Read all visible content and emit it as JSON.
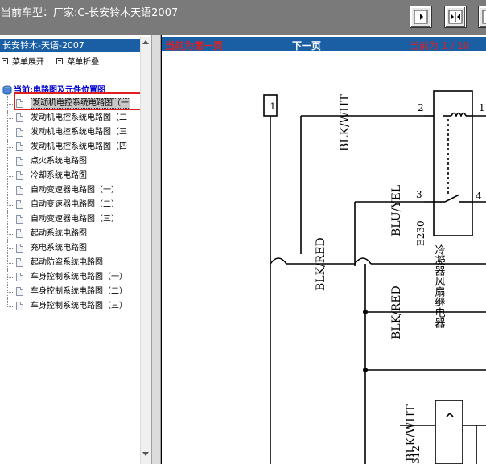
{
  "header": {
    "title": "当前车型：厂家:C-长安铃木天语2007",
    "buttons": [
      {
        "name": "single-page-button",
        "icon": "single-page-icon"
      },
      {
        "name": "double-page-button",
        "icon": "double-page-icon"
      },
      {
        "name": "fit-width-button",
        "icon": "fit-width-icon"
      }
    ]
  },
  "sidebar": {
    "title": "长安铃木-天语-2007",
    "expand_label": "菜单展开",
    "collapse_label": "菜单折叠",
    "root_label": "当前:电路图及元件位置图",
    "items": [
      "发动机电控系统电路图（一",
      "发动机电控系统电路图（二",
      "发动机电控系统电路图（三",
      "发动机电控系统电路图（四",
      "点火系统电路图",
      "冷却系统电路图",
      "自动变速器电路图（一）",
      "自动变速器电路图（二）",
      "自动变速器电路图（三）",
      "起动系统电路图",
      "充电系统电路图",
      "起动防盗系统电路图",
      "车身控制系统电路图（一）",
      "车身控制系统电路图（二）",
      "车身控制系统电路图（三）"
    ],
    "selected_index": 0
  },
  "viewer": {
    "first_page_label": "当前为第一页",
    "next_page_label": "下一页",
    "page_indicator": "当前为 1 / 10",
    "colors": {
      "nav_bg": "#1a5fa3",
      "first_page": "#e02020",
      "next_page": "#ffffff",
      "indicator": "#e02020"
    },
    "schematic": {
      "connector_label": "1",
      "wire_labels": [
        "BLK/WHT",
        "BLU/YEL",
        "BLK/RED",
        "BLK/RED",
        "BLK/WHT"
      ],
      "pin_labels": [
        "2",
        "1",
        "3",
        "4"
      ],
      "component_code": "E230",
      "component_name": "冷凝器风扇继电器",
      "bottom_code": "312"
    }
  }
}
